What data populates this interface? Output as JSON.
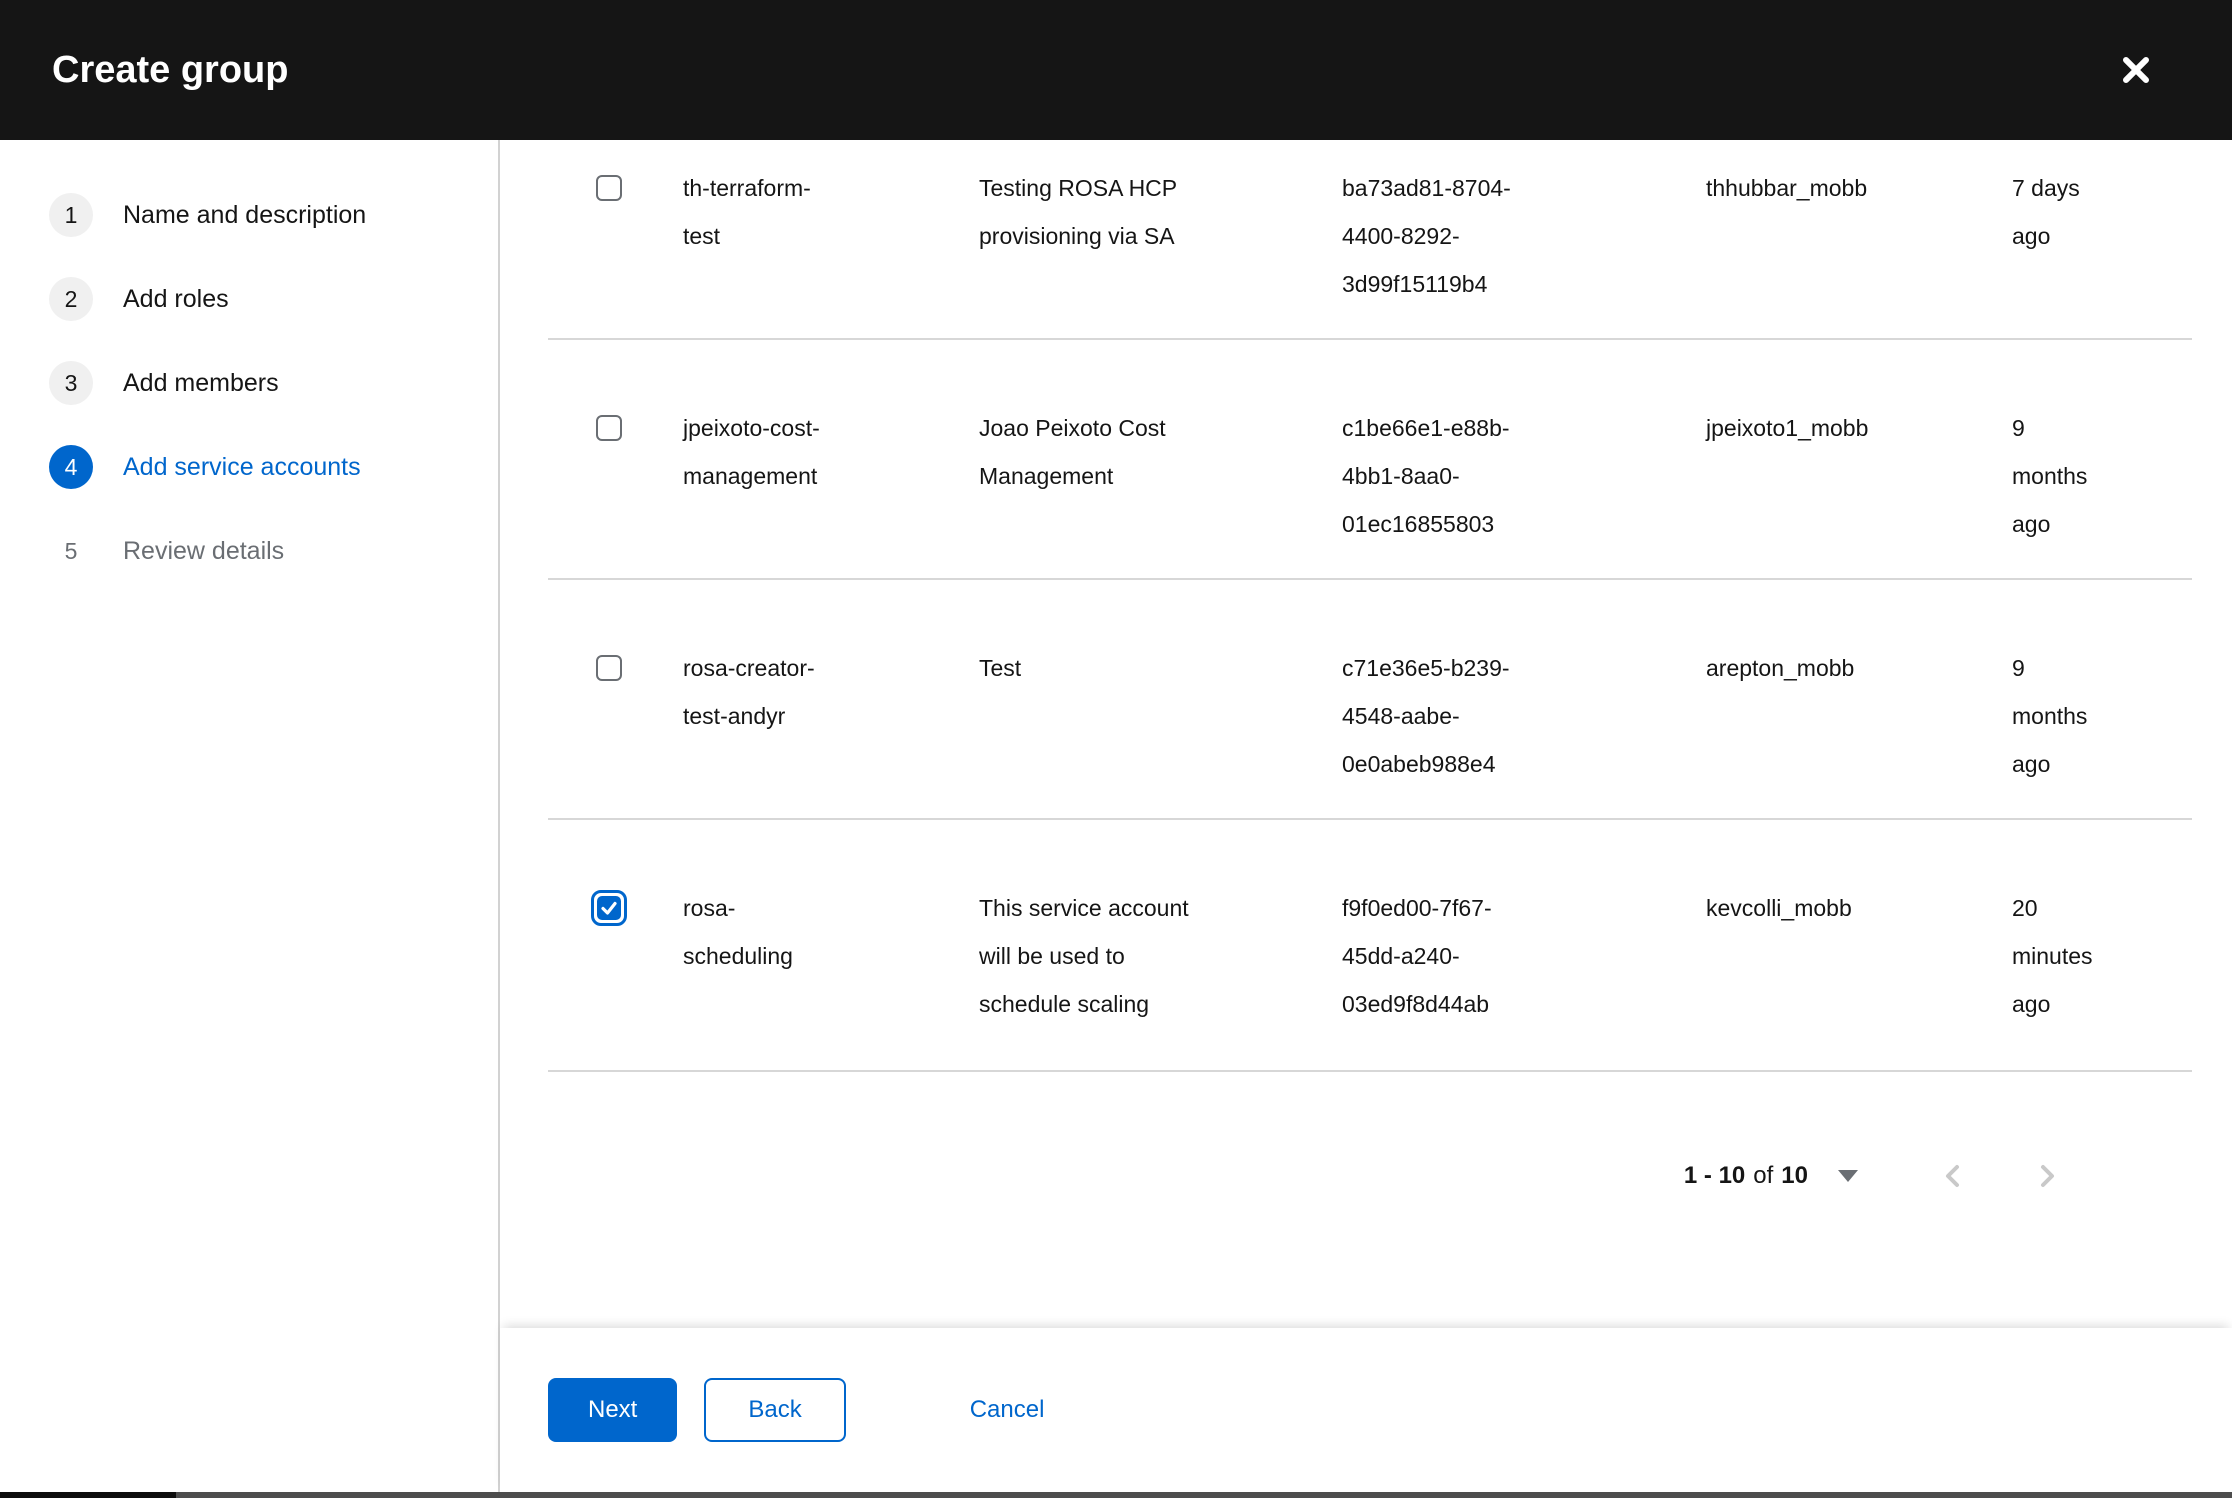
{
  "header": {
    "title": "Create group"
  },
  "icons": {
    "close": "close-icon",
    "caret_down": "caret-down-icon",
    "chevron_left": "chevron-left-icon",
    "chevron_right": "chevron-right-icon",
    "checkmark": "checkmark-icon"
  },
  "colors": {
    "primary_blue": "#0066cc",
    "header_bg": "#151515",
    "text_dark": "#151515",
    "text_gray": "#6a6e73",
    "border_gray": "#d2d2d2",
    "step_circle_gray": "#f0f0f0"
  },
  "wizard_steps": [
    {
      "number": "1",
      "label": "Name and description",
      "state": "default"
    },
    {
      "number": "2",
      "label": "Add roles",
      "state": "default"
    },
    {
      "number": "3",
      "label": "Add members",
      "state": "default"
    },
    {
      "number": "4",
      "label": "Add service accounts",
      "state": "current"
    },
    {
      "number": "5",
      "label": "Review details",
      "state": "disabled"
    }
  ],
  "table": {
    "rows": [
      {
        "checked": false,
        "name": "th-terraform-test",
        "description": "Testing ROSA HCP provisioning via SA",
        "client_id": "ba73ad81-8704-4400-8292-3d99f15119b4",
        "owner": "thhubbar_mobb",
        "time_created": "7 days ago"
      },
      {
        "checked": false,
        "name": "jpeixoto-cost-management",
        "description": "Joao Peixoto Cost Management",
        "client_id": "c1be66e1-e88b-4bb1-8aa0-01ec16855803",
        "owner": "jpeixoto1_mobb",
        "time_created": "9 months ago"
      },
      {
        "checked": false,
        "name": "rosa-creator-test-andyr",
        "description": "Test",
        "client_id": "c71e36e5-b239-4548-aabe-0e0abeb988e4",
        "owner": "arepton_mobb",
        "time_created": "9 months ago"
      },
      {
        "checked": true,
        "name": "rosa-scheduling",
        "description": "This service account will be used to schedule scaling",
        "client_id": "f9f0ed00-7f67-45dd-a240-03ed9f8d44ab",
        "owner": "kevcolli_mobb",
        "time_created": "20 minutes ago"
      }
    ]
  },
  "pagination": {
    "range_label": "1 - 10",
    "of_label": "of",
    "total_label": "10"
  },
  "footer": {
    "next_label": "Next",
    "back_label": "Back",
    "cancel_label": "Cancel"
  }
}
